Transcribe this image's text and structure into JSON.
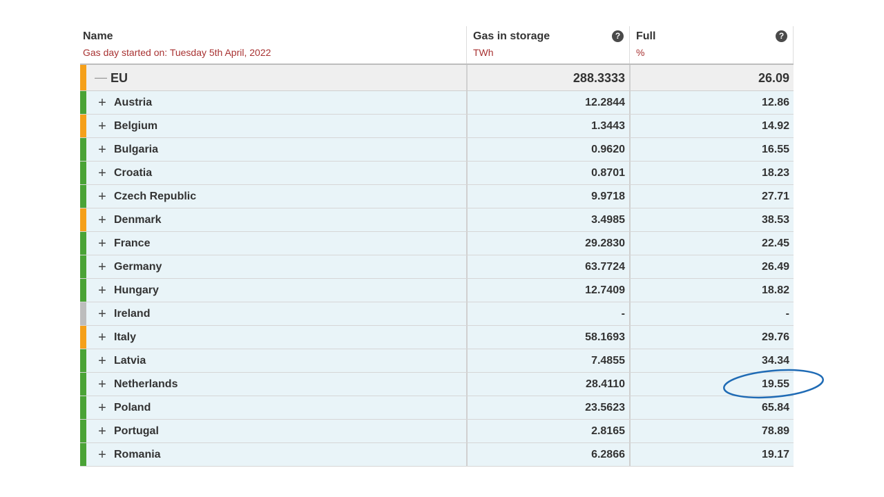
{
  "header": {
    "name_title": "Name",
    "gas_day": "Gas day started on: Tuesday 5th April, 2022",
    "gas_title": "Gas in storage",
    "gas_unit": "TWh",
    "full_title": "Full",
    "full_unit": "%",
    "help_glyph": "?"
  },
  "colors": {
    "green": "#4aa336",
    "orange": "#f5a01a",
    "grey": "#bdbdbd",
    "annotation": "#1f6bb5"
  },
  "eu": {
    "toggle": "—",
    "name": "EU",
    "gas": "288.3333",
    "full": "26.09",
    "status": "orange"
  },
  "rows": [
    {
      "toggle": "+",
      "name": "Austria",
      "gas": "12.2844",
      "full": "12.86",
      "status": "green"
    },
    {
      "toggle": "+",
      "name": "Belgium",
      "gas": "1.3443",
      "full": "14.92",
      "status": "orange"
    },
    {
      "toggle": "+",
      "name": "Bulgaria",
      "gas": "0.9620",
      "full": "16.55",
      "status": "green"
    },
    {
      "toggle": "+",
      "name": "Croatia",
      "gas": "0.8701",
      "full": "18.23",
      "status": "green"
    },
    {
      "toggle": "+",
      "name": "Czech Republic",
      "gas": "9.9718",
      "full": "27.71",
      "status": "green"
    },
    {
      "toggle": "+",
      "name": "Denmark",
      "gas": "3.4985",
      "full": "38.53",
      "status": "orange"
    },
    {
      "toggle": "+",
      "name": "France",
      "gas": "29.2830",
      "full": "22.45",
      "status": "green"
    },
    {
      "toggle": "+",
      "name": "Germany",
      "gas": "63.7724",
      "full": "26.49",
      "status": "green"
    },
    {
      "toggle": "+",
      "name": "Hungary",
      "gas": "12.7409",
      "full": "18.82",
      "status": "green"
    },
    {
      "toggle": "+",
      "name": "Ireland",
      "gas": "-",
      "full": "-",
      "status": "grey"
    },
    {
      "toggle": "+",
      "name": "Italy",
      "gas": "58.1693",
      "full": "29.76",
      "status": "orange"
    },
    {
      "toggle": "+",
      "name": "Latvia",
      "gas": "7.4855",
      "full": "34.34",
      "status": "green"
    },
    {
      "toggle": "+",
      "name": "Netherlands",
      "gas": "28.4110",
      "full": "19.55",
      "status": "green"
    },
    {
      "toggle": "+",
      "name": "Poland",
      "gas": "23.5623",
      "full": "65.84",
      "status": "green"
    },
    {
      "toggle": "+",
      "name": "Portugal",
      "gas": "2.8165",
      "full": "78.89",
      "status": "green"
    },
    {
      "toggle": "+",
      "name": "Romania",
      "gas": "6.2866",
      "full": "19.17",
      "status": "green"
    }
  ]
}
